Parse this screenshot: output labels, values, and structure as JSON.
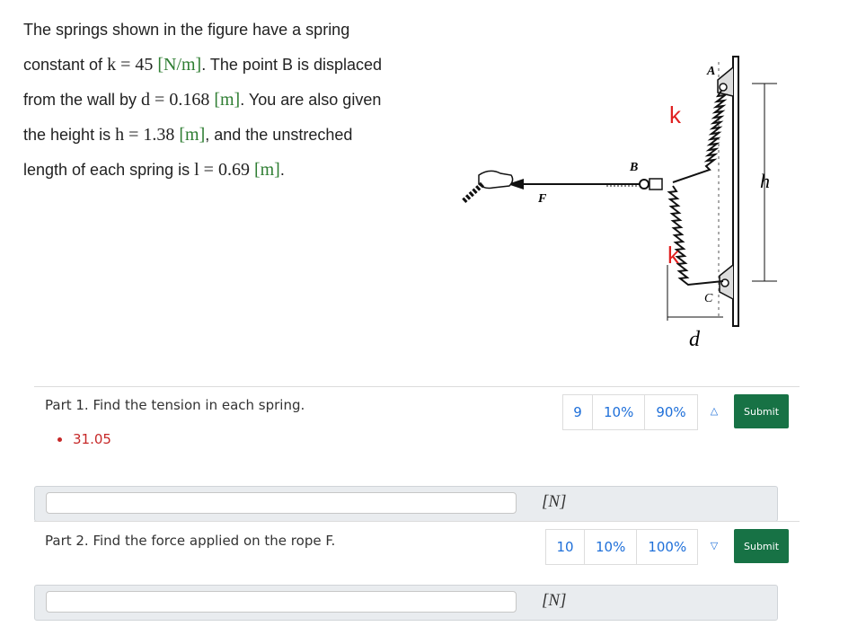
{
  "problem": {
    "seg1": "The springs shown in the figure have a spring constant of ",
    "k_expr": "k = 45 ",
    "k_unit": "[N/m]",
    "seg2": ". The point B is displaced from the wall by ",
    "d_expr": "d = 0.168 ",
    "d_unit": "[m]",
    "seg3": ". You are also given the height is ",
    "h_expr": "h = 1.38 ",
    "h_unit": "[m]",
    "seg4": ", and the unstreched length of each spring is ",
    "l_expr": "l = 0.69 ",
    "l_unit": "[m]",
    "seg5": "."
  },
  "figure": {
    "label_A": "A",
    "label_B": "B",
    "label_C": "C",
    "label_F": "F",
    "label_k_top": "k",
    "label_k_bottom": "k",
    "label_h": "h",
    "label_d": "d"
  },
  "parts": [
    {
      "title": "Part 1. Find the tension in each spring.",
      "attempts": "9",
      "stat1": "10%",
      "stat2": "90%",
      "toggle": "△",
      "submit": "Submit",
      "prev_answer": "31.05",
      "input_value": "",
      "unit": "[N]"
    },
    {
      "title": "Part 2. Find the force applied on the rope F.",
      "attempts": "10",
      "stat1": "10%",
      "stat2": "100%",
      "toggle": "▽",
      "submit": "Submit",
      "input_value": "",
      "unit": "[N]"
    }
  ],
  "colors": {
    "submit_bg": "#177245",
    "unit_green": "#2e7d32",
    "spring_label_red": "#e02020",
    "prev_answer_red": "#c62828",
    "link_blue": "#1e6fd9"
  }
}
